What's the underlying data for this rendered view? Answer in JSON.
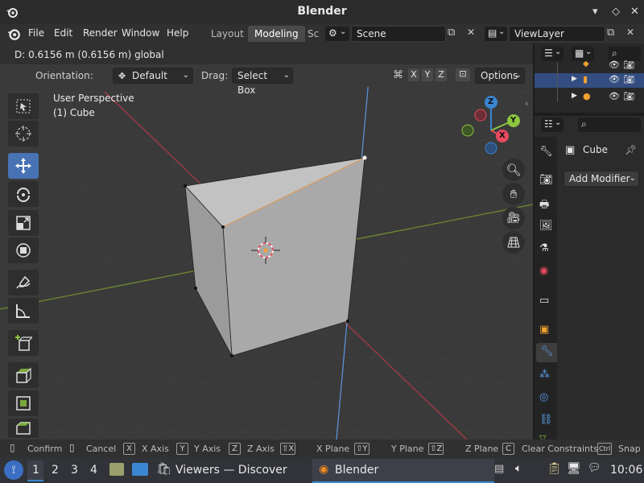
{
  "window": {
    "title": "Blender"
  },
  "menu": [
    "File",
    "Edit",
    "Render",
    "Window",
    "Help"
  ],
  "workspace_tabs": [
    "Layout",
    "Modeling",
    "Sc"
  ],
  "scene": {
    "value": "Scene"
  },
  "view_layer": {
    "value": "ViewLayer"
  },
  "header": {
    "transform_info": "D: 0.6156 m (0.6156 m) global",
    "orientation_label": "Orientation:",
    "orientation_value": "Default",
    "drag_label": "Drag:",
    "drag_value": "Select Box",
    "axes": [
      "X",
      "Y",
      "Z"
    ],
    "options_label": "Options"
  },
  "viewport": {
    "perspective": "User Perspective",
    "object": "(1) Cube"
  },
  "gizmo": {
    "z": "Z",
    "y": "Y",
    "x": "X"
  },
  "properties": {
    "object_name": "Cube",
    "add_modifier": "Add Modifier"
  },
  "status": {
    "items": [
      {
        "key": "",
        "label": "Confirm"
      },
      {
        "key": "",
        "label": "Cancel"
      },
      {
        "key": "X",
        "label": "X Axis"
      },
      {
        "key": "Y",
        "label": "Y Axis"
      },
      {
        "key": "Z",
        "label": "Z Axis"
      },
      {
        "key": "⇧X",
        "label": "X Plane"
      },
      {
        "key": "⇧Y",
        "label": "Y Plane"
      },
      {
        "key": "⇧Z",
        "label": "Z Plane"
      },
      {
        "key": "C",
        "label": "Clear Constraints"
      },
      {
        "key": "Ctrl",
        "label": "Snap I"
      }
    ]
  },
  "taskbar": {
    "workspaces": [
      "1",
      "2",
      "3",
      "4"
    ],
    "apps": [
      {
        "label": "Viewers — Discover"
      },
      {
        "label": "Blender"
      }
    ],
    "clock": "10:06"
  },
  "colors": {
    "accent": "#4772b3",
    "x_axis": "#e84a5f",
    "y_axis": "#8cc63f",
    "z_axis": "#3a86d1"
  }
}
